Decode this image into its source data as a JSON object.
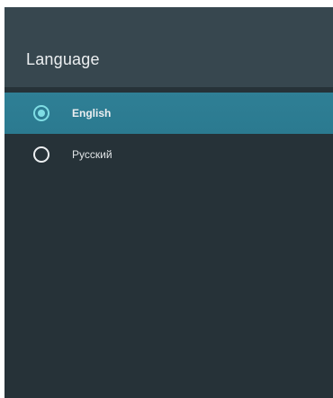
{
  "dialog": {
    "title": "Language"
  },
  "options": [
    {
      "label": "English",
      "selected": true
    },
    {
      "label": "Русский",
      "selected": false
    }
  ],
  "colors": {
    "panel_background": "#263238",
    "header_background": "#37474f",
    "selected_row": "#2e7d92",
    "radio_accent": "#7fdde4",
    "text": "#eceff1"
  },
  "icons": {
    "selected": "radio-selected-icon",
    "unselected": "radio-unselected-icon"
  }
}
